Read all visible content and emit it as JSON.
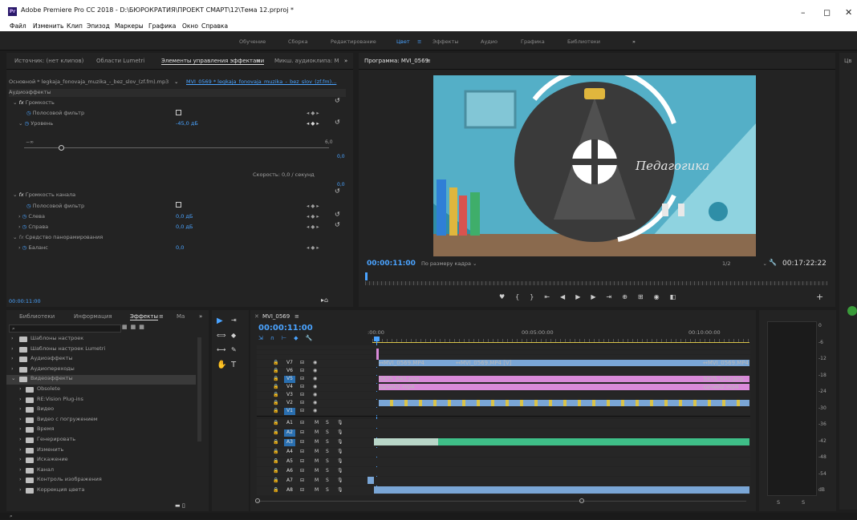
{
  "window": {
    "title": "Adobe Premiere Pro CC 2018 - D:\\БЮРОКРАТИЯ\\ПРОЕКТ СМАРТ\\12\\Тема 12.prproj *",
    "logo": "Pr",
    "min": "–",
    "max": "◻",
    "close": "✕"
  },
  "menu": [
    "Файл",
    "Изменить",
    "Клип",
    "Эпизод",
    "Маркеры",
    "Графика",
    "Окно",
    "Справка"
  ],
  "workspaces": [
    "Обучение",
    "Сборка",
    "Редактирование",
    "Цвет",
    "Эффекты",
    "Аудио",
    "Графика",
    "Библиотеки"
  ],
  "ws_more": "»",
  "source": {
    "tabs": [
      "Источник: (нет клипов)",
      "Области Lumetri",
      "Элементы управления эффектами",
      "Микш. аудиоклипа: M"
    ],
    "more": "»",
    "clip": "Основной * legkaja_fonovaja_muzika_-_bez_slov_(zf.fm).mp3",
    "seq": "MVI_0569 * legkaja_fonovaja_muzika_-_bez_slov_(zf.fm)...",
    "section": "Аудиоэффекты",
    "fx1": "Громкость",
    "bypass": "Полосовой фильтр",
    "level": "Уровень",
    "level_val": "-45,0 дБ",
    "max_val": "6,0",
    "zero": "0,0",
    "speed": "Скорость: 0,0 / секунд",
    "fx2": "Громкость канала",
    "left": "Слева",
    "left_val": "0,0 дБ",
    "right": "Справа",
    "right_val": "0,0 дБ",
    "fx3": "Средство панорамирования",
    "balance": "Баланс",
    "balance_val": "0,0",
    "time": "00:00:11:00",
    "min_label": "−∞"
  },
  "program": {
    "title": "Программа: MVI_0569",
    "tc": "00:00:11:00",
    "fit": "По размеру кадра",
    "ratio": "1/2",
    "duration": "00:17:22:22",
    "logo_text": "Педагогика",
    "right_tab": "Цв"
  },
  "effects": {
    "tabs": [
      "Библиотеки",
      "Информация",
      "Эффекты",
      "Ma"
    ],
    "more": "»",
    "items": [
      "Шаблоны настроек",
      "Шаблоны настроек Lumetri",
      "Аудиоэффекты",
      "Аудиопереходы",
      "Видеоэффекты",
      "Obsolete",
      "RE:Vision Plug-ins",
      "Видео",
      "Видео с погружением",
      "Время",
      "Генерировать",
      "Изменить",
      "Искажение",
      "Канал",
      "Контроль изображения",
      "Коррекция цвета"
    ]
  },
  "timeline": {
    "seq": "MVI_0569",
    "tc": "00:00:11:00",
    "rulers": [
      ":00:00",
      "00:05:00:00",
      "00:10:00:00"
    ],
    "vtracks": [
      "V7",
      "V6",
      "V5",
      "V4",
      "V3",
      "V2",
      "V1"
    ],
    "atracks": [
      "A1",
      "A2",
      "A3",
      "A4",
      "A5",
      "A6",
      "A7",
      "A8"
    ],
    "clip_mvi": "↔MVI_0569.MP4",
    "clip_mvi_v": "↔MVI_0569.MP4 [V]",
    "clip_png": "5875_640.png",
    "clip_mp4": "одчий2.mp4",
    "m": "M",
    "s": "S"
  },
  "meter": {
    "labels": [
      "0",
      "-6",
      "-12",
      "-18",
      "-24",
      "-30",
      "-36",
      "-42",
      "-48",
      "-54",
      "dB"
    ],
    "s1": "S",
    "s2": "S"
  },
  "chart_colors": {
    "accent": "#4aa3ff",
    "video_clip": "#7aa6d6",
    "pink_clip": "#d98ad9",
    "audio_green": "#3fbf88"
  }
}
